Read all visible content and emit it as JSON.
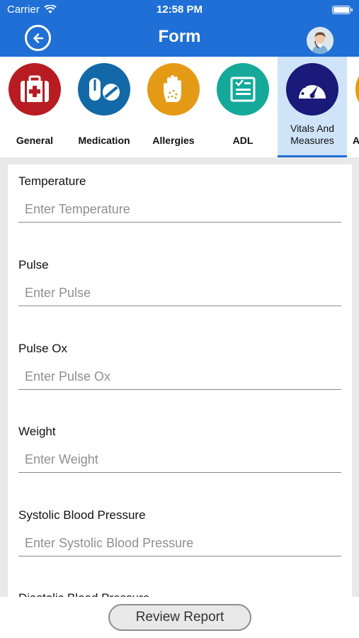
{
  "status_bar": {
    "carrier": "Carrier",
    "time": "12:58 PM"
  },
  "header": {
    "title": "Form"
  },
  "categories": [
    {
      "label": "General",
      "color": "#b81c22",
      "icon": "first-aid-kit-icon"
    },
    {
      "label": "Medication",
      "color": "#1368a8",
      "icon": "pills-icon"
    },
    {
      "label": "Allergies",
      "color": "#e59a16",
      "icon": "rash-hand-icon"
    },
    {
      "label": "ADL",
      "color": "#15a99a",
      "icon": "checklist-icon"
    },
    {
      "label": "Vitals And Measures",
      "line1": "Vitals And",
      "line2": "Measures",
      "color": "#1a1a7a",
      "icon": "gauge-icon",
      "active": true
    },
    {
      "label": "A",
      "color": "#e59a16",
      "icon": "partial-icon"
    }
  ],
  "fields": [
    {
      "label": "Temperature",
      "placeholder": "Enter Temperature"
    },
    {
      "label": "Pulse",
      "placeholder": "Enter Pulse"
    },
    {
      "label": "Pulse Ox",
      "placeholder": "Enter Pulse Ox"
    },
    {
      "label": "Weight",
      "placeholder": "Enter Weight"
    },
    {
      "label": "Systolic Blood Pressure",
      "placeholder": "Enter Systolic Blood Pressure"
    },
    {
      "label": "Diastolic Blood Pressure"
    }
  ],
  "footer": {
    "review_label": "Review Report"
  },
  "colors": {
    "header_bg": "#1f6fd6",
    "active_tab_bg": "#cfe4f8"
  }
}
